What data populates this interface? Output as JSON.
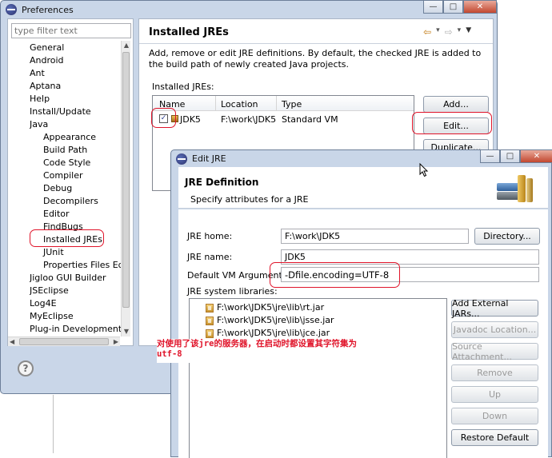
{
  "preferences": {
    "title": "Preferences",
    "filter_placeholder": "type filter text",
    "tree": [
      "General",
      "Android",
      "Ant",
      "Aptana",
      "Help",
      "Install/Update",
      "Java",
      "Appearance",
      "Build Path",
      "Code Style",
      "Compiler",
      "Debug",
      "Decompilers",
      "Editor",
      "FindBugs",
      "Installed JREs",
      "JUnit",
      "Properties Files Editor",
      "Jigloo GUI Builder",
      "JSEclipse",
      "Log4E",
      "MyEclipse",
      "Plug-in Development"
    ],
    "help_icon": "?",
    "page_title": "Installed JREs",
    "description": "Add, remove or edit JRE definitions. By default, the checked JRE is added to the build path of newly created Java projects.",
    "installed_label": "Installed JREs:",
    "columns": [
      "Name",
      "Location",
      "Type"
    ],
    "rows": [
      {
        "name": "JDK5",
        "location": "F:\\work\\JDK5",
        "type": "Standard VM"
      }
    ],
    "buttons": {
      "add": "Add...",
      "edit": "Edit...",
      "duplicate": "Duplicate..."
    }
  },
  "edit_jre": {
    "title": "Edit JRE",
    "header_title": "JRE Definition",
    "header_desc": "Specify attributes for a JRE",
    "labels": {
      "home": "JRE home:",
      "name": "JRE name:",
      "vm_args": "Default VM Arguments:",
      "libs": "JRE system libraries:"
    },
    "values": {
      "home": "F:\\work\\JDK5",
      "name": "JDK5",
      "vm_args": "-Dfile.encoding=UTF-8"
    },
    "libraries": [
      "F:\\work\\JDK5\\jre\\lib\\rt.jar",
      "F:\\work\\JDK5\\jre\\lib\\jsse.jar",
      "F:\\work\\JDK5\\jre\\lib\\jce.jar"
    ],
    "buttons": {
      "directory": "Directory...",
      "add_external": "Add External JARs...",
      "javadoc": "Javadoc Location...",
      "source": "Source Attachment...",
      "remove": "Remove",
      "up": "Up",
      "down": "Down",
      "restore": "Restore Default"
    }
  },
  "annotation": {
    "line1": "对使用了该jre的服务器，在启动时都设置其字符集为",
    "line2": "utf-8"
  },
  "colors": {
    "annotation_red": "#e0142a",
    "accent": "#1f5fbf"
  }
}
